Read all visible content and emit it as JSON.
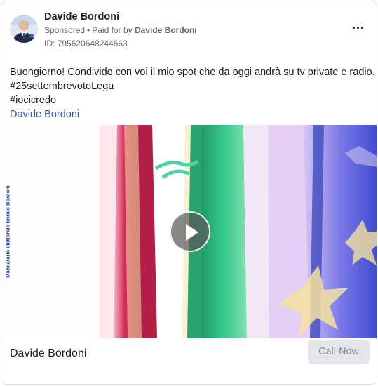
{
  "post": {
    "author_name": "Davide Bordoni",
    "sponsored_label": "Sponsored",
    "separator": "•",
    "paid_for_prefix": "Paid for by",
    "paid_for_name": "Davide Bordoni",
    "ad_id": "ID: 795620648244663",
    "more_icon": "ellipsis-icon"
  },
  "body": {
    "lines": [
      "Buongiorno! Condivido con voi il mio spot che da oggi andrà su tv private e radio.",
      "#25settembrevotoLega",
      "#iocicredo"
    ],
    "link": "Davide Bordoni"
  },
  "media": {
    "vertical_text": "Mandatario elettorale Enrico Bordoni",
    "play_icon": "play-icon"
  },
  "footer": {
    "title": "Davide Bordoni",
    "cta_label": "Call Now"
  },
  "colors": {
    "link": "#385898",
    "cta_bg": "#e4e6eb",
    "cta_text": "#8a8d91",
    "flag_red": "#c8234f",
    "flag_green": "#2fbf86",
    "eu_blue": "#4b58d6",
    "eu_star": "#f4e1a0"
  }
}
